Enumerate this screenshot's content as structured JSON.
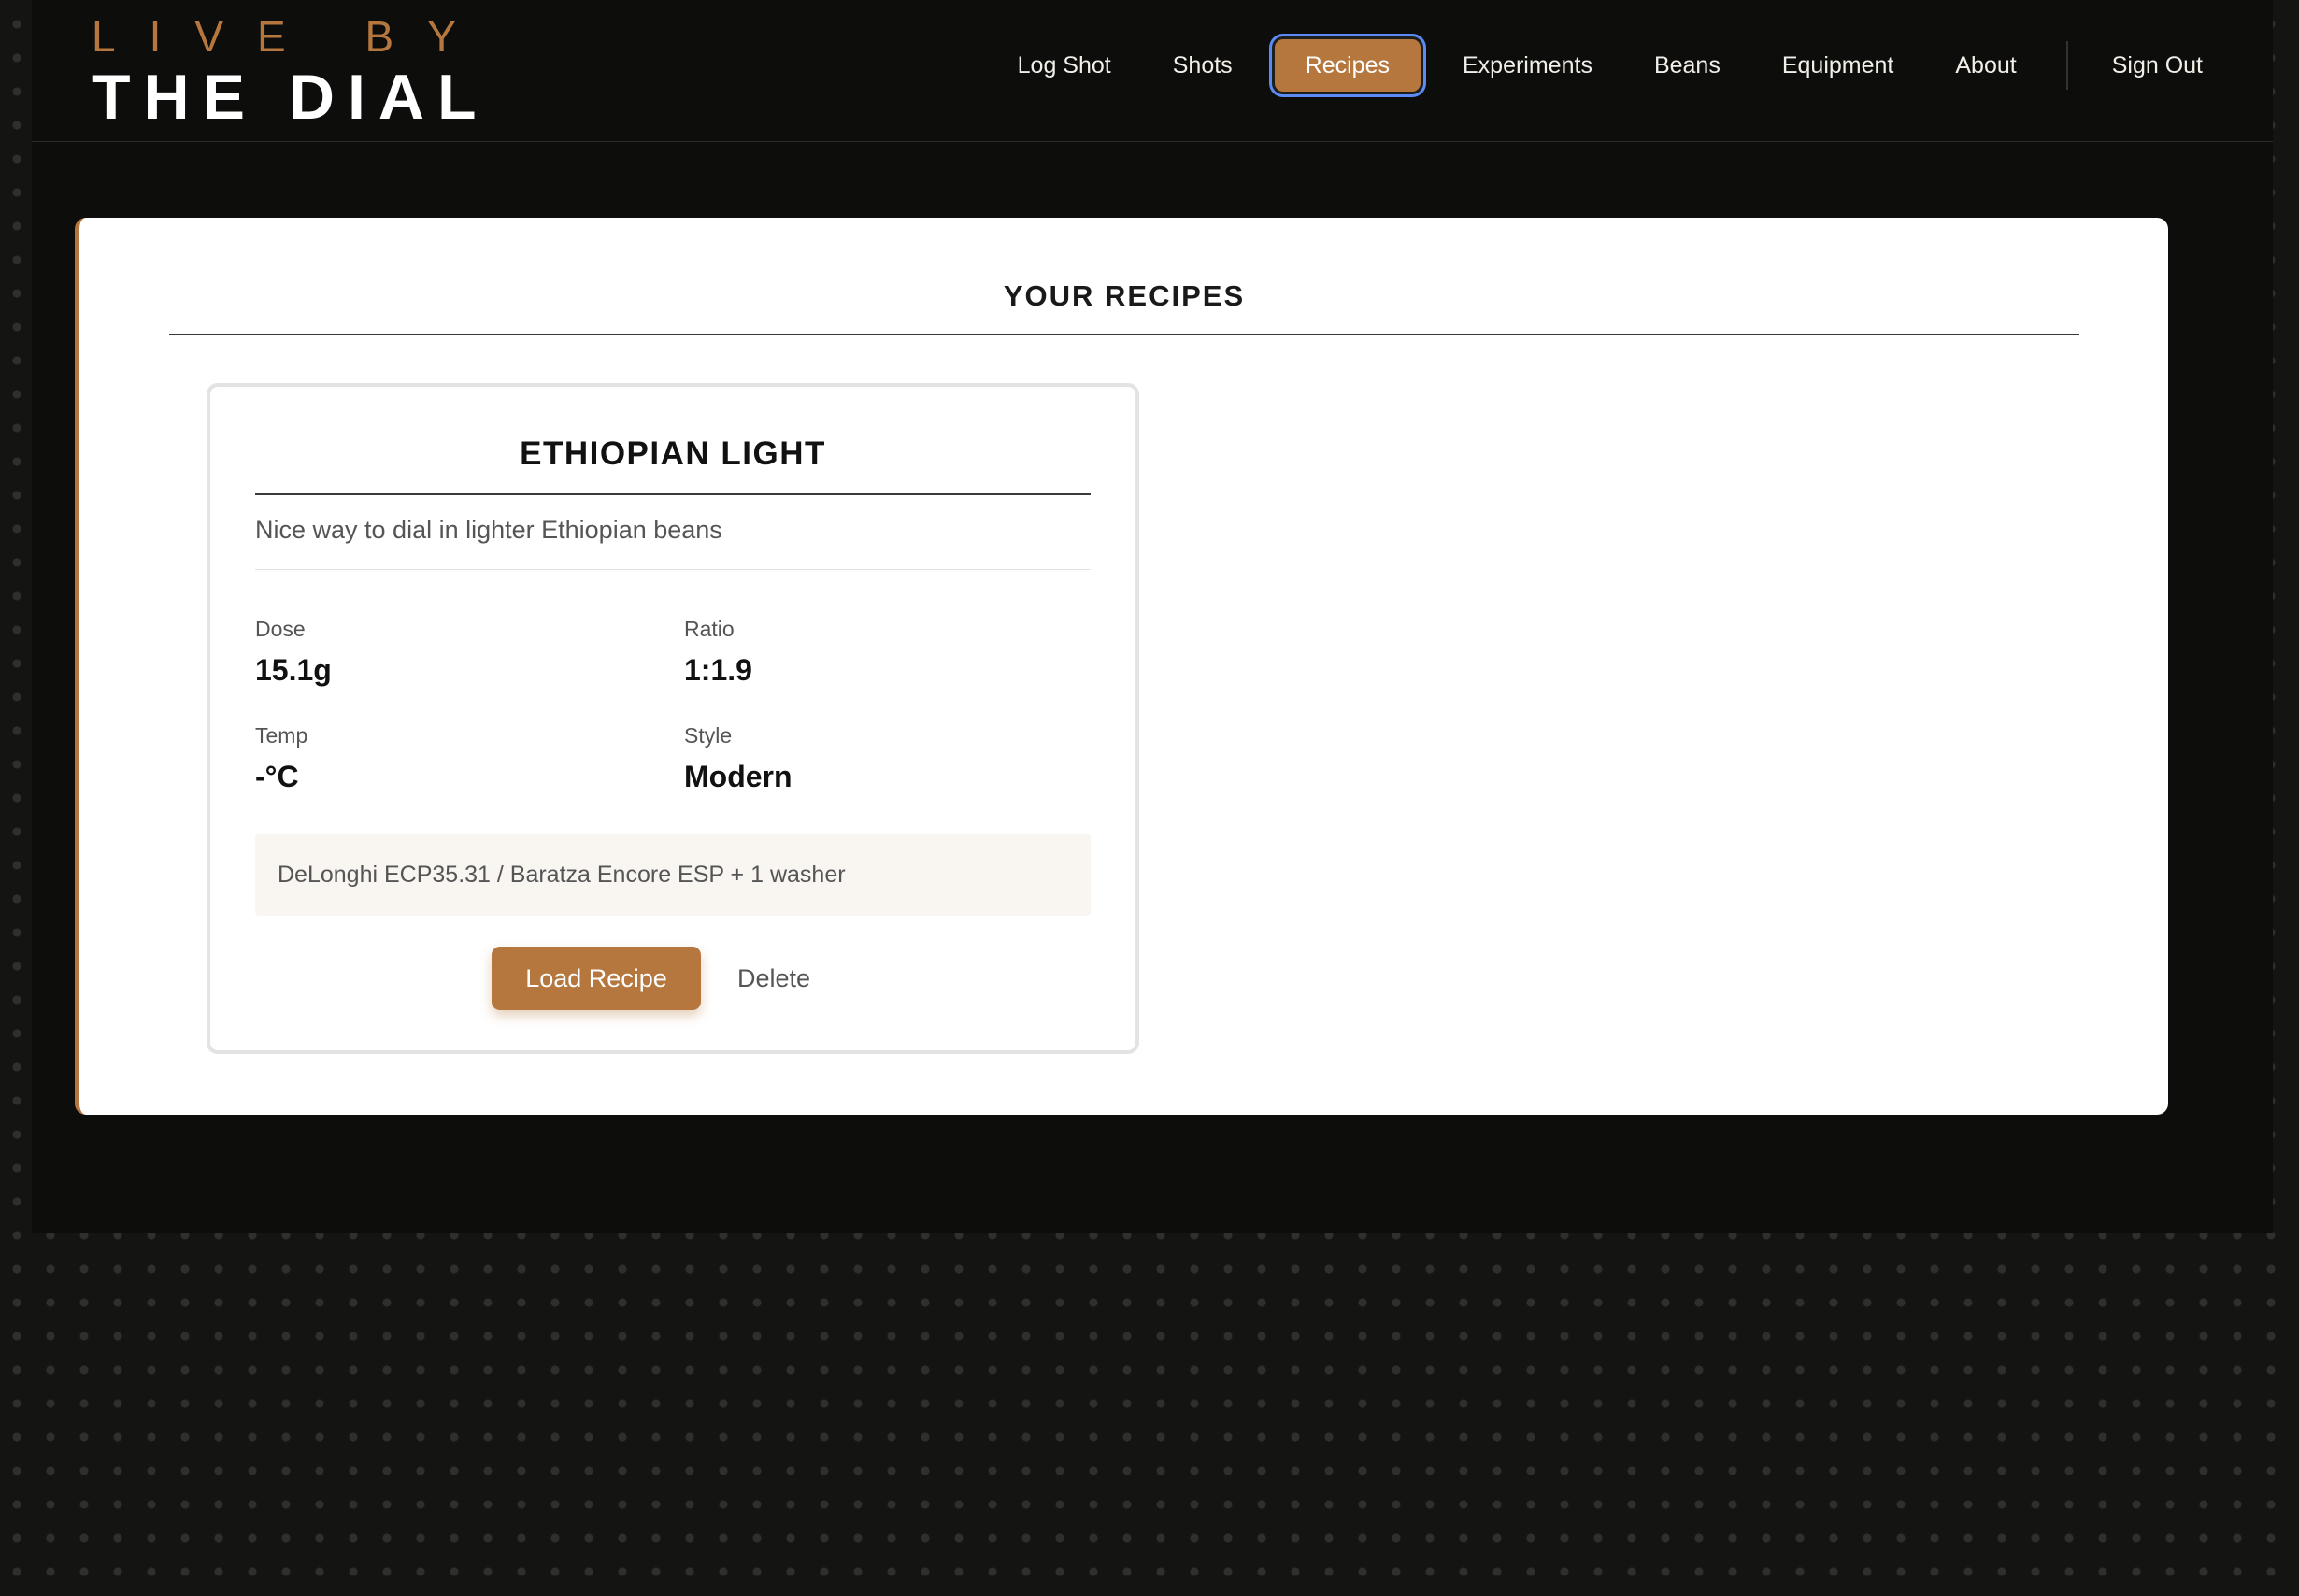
{
  "brand": {
    "top": "LIVE BY",
    "main": "THE DIAL"
  },
  "nav": {
    "items": [
      {
        "label": "Log Shot"
      },
      {
        "label": "Shots"
      },
      {
        "label": "Recipes",
        "active": true
      },
      {
        "label": "Experiments"
      },
      {
        "label": "Beans"
      },
      {
        "label": "Equipment"
      },
      {
        "label": "About"
      }
    ],
    "sign_out": "Sign Out"
  },
  "main": {
    "section_title": "YOUR RECIPES",
    "recipes": [
      {
        "name": "ETHIOPIAN LIGHT",
        "description": "Nice way to dial in lighter Ethiopian beans",
        "dose_label": "Dose",
        "dose_value": "15.1g",
        "ratio_label": "Ratio",
        "ratio_value": "1:1.9",
        "temp_label": "Temp",
        "temp_value": "-°C",
        "style_label": "Style",
        "style_value": "Modern",
        "equipment": "DeLonghi ECP35.31 / Baratza Encore ESP + 1 washer",
        "load_label": "Load Recipe",
        "delete_label": "Delete"
      }
    ]
  },
  "colors": {
    "accent": "#b5773e",
    "background": "#0d0d0b",
    "focus_ring": "#5c8bf5"
  }
}
